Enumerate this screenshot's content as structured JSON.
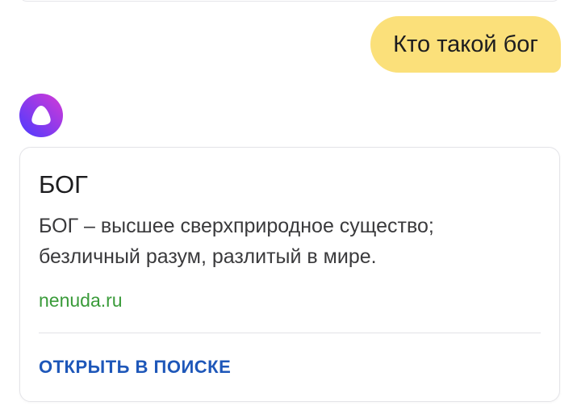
{
  "user_message": {
    "text": "Кто такой бог"
  },
  "assistant": {
    "icon": "alice-icon",
    "card": {
      "title": "БОГ",
      "text": "БОГ – высшее сверхприродное существо; безличный разум, разлитый в мире.",
      "source": "nenuda.ru",
      "action_label": "ОТКРЫТЬ В ПОИСКЕ"
    }
  },
  "colors": {
    "user_bubble": "#fbe07a",
    "source_link": "#3a9b3a",
    "action_link": "#1e57b9",
    "icon_gradient_start": "#4a3bff",
    "icon_gradient_end": "#d53ad6"
  }
}
